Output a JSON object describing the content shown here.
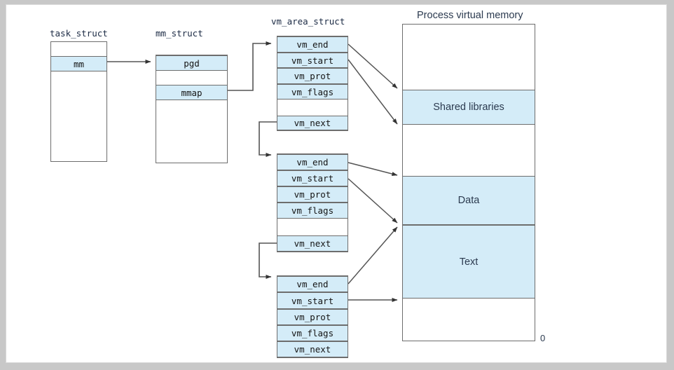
{
  "figure": {
    "title_labels": {
      "task_struct": "task_struct",
      "mm_struct": "mm_struct",
      "vm_area_struct": "vm_area_struct",
      "process_virtual_memory": "Process virtual memory"
    }
  },
  "task_struct": {
    "label": "task_struct",
    "rows": [
      {
        "text": "",
        "filled": false
      },
      {
        "text": "mm",
        "filled": true
      },
      {
        "text": "",
        "filled": false
      }
    ]
  },
  "mm_struct": {
    "label": "mm_struct",
    "rows": [
      {
        "text": "pgd",
        "filled": true
      },
      {
        "text": "",
        "filled": false
      },
      {
        "text": "mmap",
        "filled": true
      },
      {
        "text": "",
        "filled": false
      }
    ]
  },
  "vm_area_structs": {
    "label": "vm_area_struct",
    "blocks": [
      {
        "name": "vma-1",
        "rows": [
          {
            "text": "vm_end",
            "filled": true
          },
          {
            "text": "vm_start",
            "filled": true
          },
          {
            "text": "vm_prot",
            "filled": true
          },
          {
            "text": "vm_flags",
            "filled": true
          },
          {
            "text": "",
            "filled": false
          },
          {
            "text": "vm_next",
            "filled": true
          }
        ]
      },
      {
        "name": "vma-2",
        "rows": [
          {
            "text": "vm_end",
            "filled": true
          },
          {
            "text": "vm_start",
            "filled": true
          },
          {
            "text": "vm_prot",
            "filled": true
          },
          {
            "text": "vm_flags",
            "filled": true
          },
          {
            "text": "",
            "filled": false
          },
          {
            "text": "vm_next",
            "filled": true
          }
        ]
      },
      {
        "name": "vma-3",
        "rows": [
          {
            "text": "vm_end",
            "filled": true
          },
          {
            "text": "vm_start",
            "filled": true
          },
          {
            "text": "vm_prot",
            "filled": true
          },
          {
            "text": "vm_flags",
            "filled": true
          },
          {
            "text": "vm_next",
            "filled": true
          }
        ]
      }
    ]
  },
  "process_memory": {
    "label": "Process virtual memory",
    "bottom_address": "0",
    "regions": [
      {
        "text": "Shared libraries",
        "filled": true
      },
      {
        "text": "Data",
        "filled": true
      },
      {
        "text": "Text",
        "filled": true
      }
    ]
  },
  "colors": {
    "fill": "#d4ecf8",
    "stroke": "#6d6d6d",
    "text": "#141414",
    "label_text": "#2b3a4f",
    "canvas": "#ffffff",
    "page_background": "#c8c8c8"
  }
}
